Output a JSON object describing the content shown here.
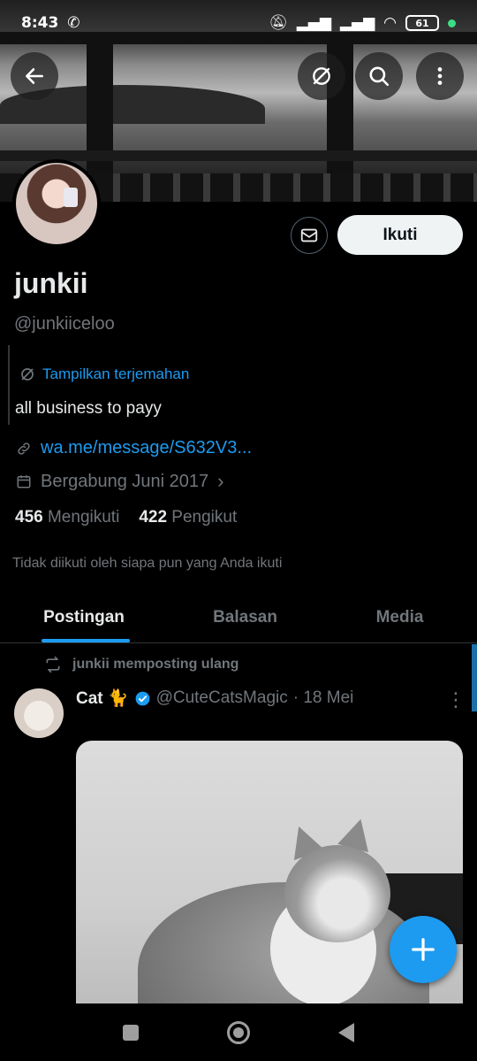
{
  "status_bar": {
    "time": "8:43",
    "battery": "61"
  },
  "profile": {
    "name": "junkii",
    "handle": "@junkiiceloo",
    "translate_label": "Tampilkan terjemahan",
    "bio": "all business to payy",
    "link": "wa.me/message/S632V3...",
    "joined": "Bergabung Juni 2017",
    "following_count": "456",
    "following_label": "Mengikuti",
    "followers_count": "422",
    "followers_label": "Pengikut",
    "not_followed_note": "Tidak diikuti oleh siapa pun yang Anda ikuti",
    "follow_button": "Ikuti"
  },
  "tabs": [
    {
      "label": "Postingan",
      "active": true
    },
    {
      "label": "Balasan",
      "active": false
    },
    {
      "label": "Media",
      "active": false
    }
  ],
  "post": {
    "repost_label": "junkii memposting ulang",
    "author_name": "Cat 🐈",
    "author_handle": "@CuteCatsMagic",
    "date": "· 18 Mei"
  },
  "icons": {
    "back": "arrow-left-icon",
    "translate": "translate-icon",
    "search": "search-icon",
    "more": "more-vertical-icon",
    "message": "envelope-icon",
    "link": "link-icon",
    "calendar": "calendar-icon",
    "repost": "repost-icon",
    "verified": "verified-badge-icon",
    "compose": "plus-icon"
  },
  "colors": {
    "accent": "#1d9bf0",
    "background": "#000000",
    "secondary_text": "#71767b"
  }
}
